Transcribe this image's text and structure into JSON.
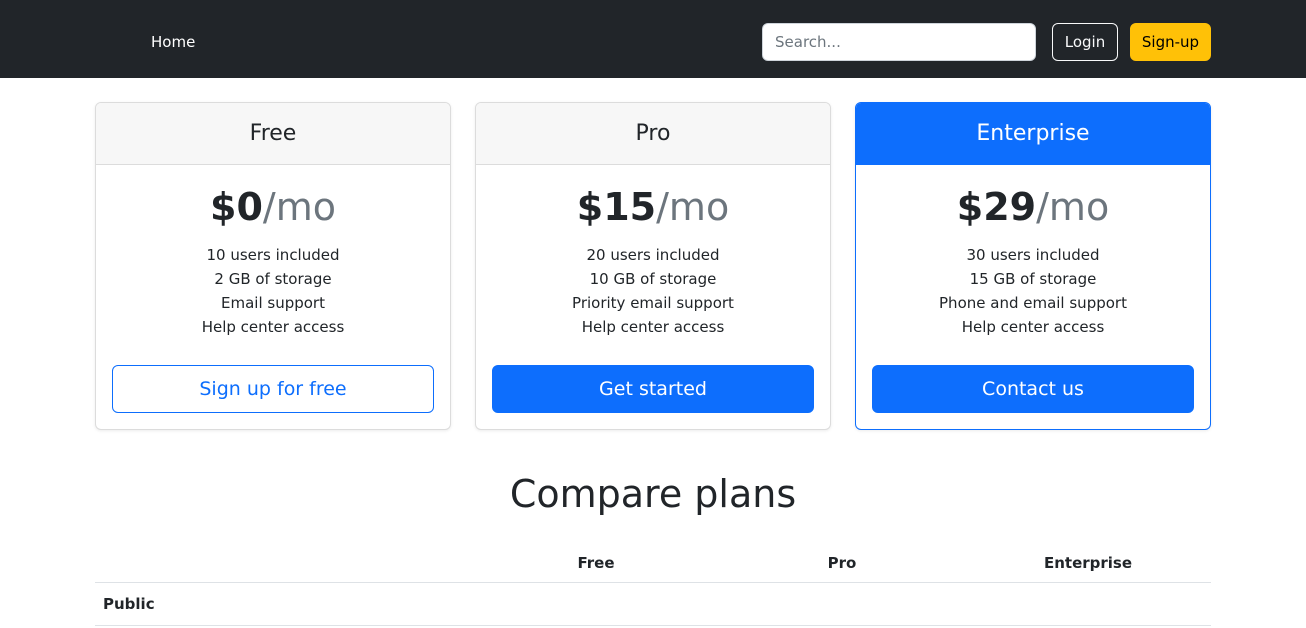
{
  "navbar": {
    "home_label": "Home",
    "search_placeholder": "Search...",
    "login_label": "Login",
    "signup_label": "Sign-up"
  },
  "plans": [
    {
      "name": "Free",
      "price": "$0",
      "unit": "/mo",
      "features": [
        "10 users included",
        "2 GB of storage",
        "Email support",
        "Help center access"
      ],
      "button_label": "Sign up for free"
    },
    {
      "name": "Pro",
      "price": "$15",
      "unit": "/mo",
      "features": [
        "20 users included",
        "10 GB of storage",
        "Priority email support",
        "Help center access"
      ],
      "button_label": "Get started"
    },
    {
      "name": "Enterprise",
      "price": "$29",
      "unit": "/mo",
      "features": [
        "30 users included",
        "15 GB of storage",
        "Phone and email support",
        "Help center access"
      ],
      "button_label": "Contact us"
    }
  ],
  "compare": {
    "title": "Compare plans",
    "columns": [
      "Free",
      "Pro",
      "Enterprise"
    ],
    "rows": [
      {
        "label": "Public"
      }
    ]
  },
  "colors": {
    "navbar_bg": "#212529",
    "primary": "#0d6efd",
    "warning": "#ffc107"
  }
}
